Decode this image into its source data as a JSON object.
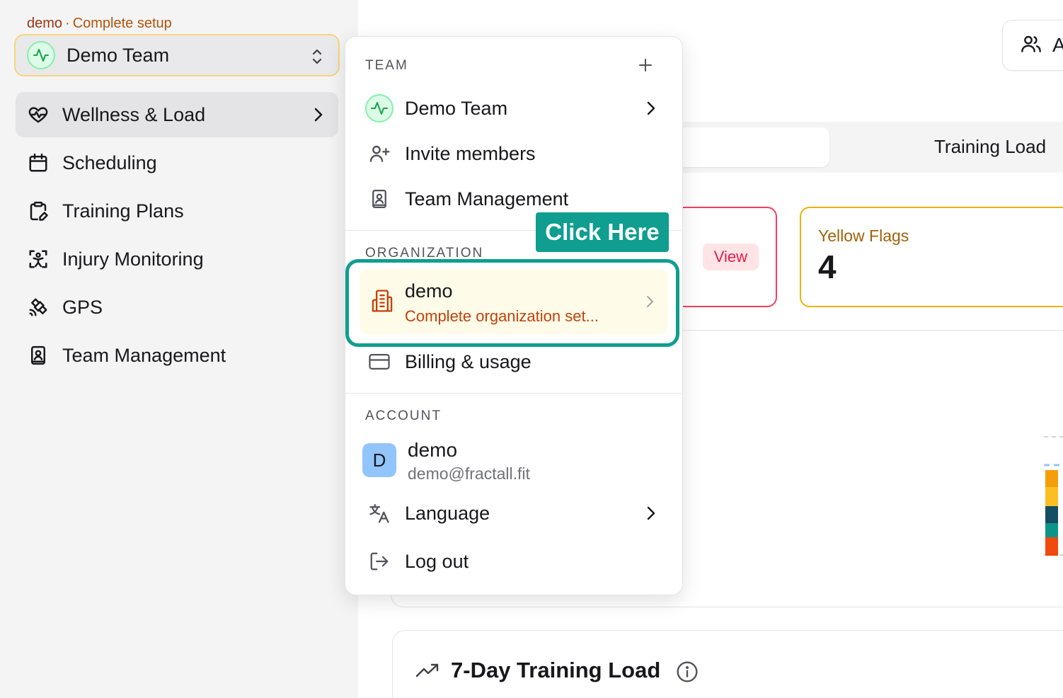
{
  "sidebar": {
    "setup": {
      "org": "demo",
      "separator": "·",
      "action": "Complete setup"
    },
    "team_switcher": {
      "name": "Demo Team"
    },
    "items": [
      {
        "label": "Wellness & Load",
        "icon": "heart-pulse-icon",
        "active": true
      },
      {
        "label": "Scheduling",
        "icon": "calendar-icon"
      },
      {
        "label": "Training Plans",
        "icon": "clipboard-edit-icon"
      },
      {
        "label": "Injury Monitoring",
        "icon": "person-scan-icon"
      },
      {
        "label": "GPS",
        "icon": "satellite-icon"
      },
      {
        "label": "Team Management",
        "icon": "contact-book-icon"
      }
    ]
  },
  "main": {
    "top_button": {
      "label": "A",
      "icon": "users-icon"
    },
    "tabs": {
      "training_load": "Training Load"
    },
    "red_card": {
      "view_label": "View"
    },
    "yellow_card": {
      "label": "Yellow Flags",
      "value": "4"
    },
    "load_card": {
      "title": "7-Day Training Load",
      "icon": "trending-up-icon"
    }
  },
  "menu": {
    "team_section": {
      "title": "TEAM",
      "items": [
        {
          "label": "Demo Team",
          "icon": "activity-icon"
        },
        {
          "label": "Invite members",
          "icon": "user-plus-icon"
        },
        {
          "label": "Team Management",
          "icon": "contact-book-icon"
        }
      ]
    },
    "org_section": {
      "title": "ORGANIZATION",
      "org": {
        "name": "demo",
        "subtitle": "Complete organization set..."
      },
      "billing": "Billing & usage"
    },
    "account_section": {
      "title": "ACCOUNT",
      "avatar_initial": "D",
      "name": "demo",
      "email": "demo@fractall.fit",
      "language": "Language",
      "logout": "Log out"
    }
  },
  "callout": {
    "label": "Click Here"
  },
  "colors": {
    "accent_teal": "#0f9e8f",
    "warning_orange": "#c2410c",
    "danger": "#f43f5e",
    "yellow": "#eab308"
  }
}
